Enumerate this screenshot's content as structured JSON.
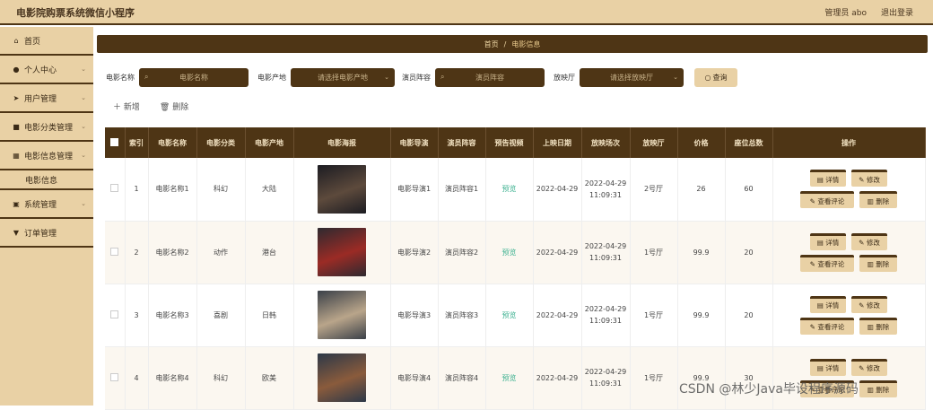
{
  "app": {
    "title": "电影院购票系统微信小程序"
  },
  "header": {
    "user_label": "管理员 abo",
    "logout": "退出登录"
  },
  "sidebar": {
    "items": [
      {
        "label": "首页",
        "icon": "home-icon",
        "glyph": "⌂",
        "has_chevron": false
      },
      {
        "label": "个人中心",
        "icon": "person-icon",
        "glyph": "●",
        "has_chevron": true
      },
      {
        "label": "用户管理",
        "icon": "send-icon",
        "glyph": "➤",
        "has_chevron": true
      },
      {
        "label": "电影分类管理",
        "icon": "folder-icon",
        "glyph": "■",
        "has_chevron": true
      },
      {
        "label": "电影信息管理",
        "icon": "grid-icon",
        "glyph": "▦",
        "has_chevron": true
      }
    ],
    "subitem": "电影信息",
    "items2": [
      {
        "label": "系统管理",
        "icon": "settings-icon",
        "glyph": "▣",
        "has_chevron": true
      },
      {
        "label": "订单管理",
        "icon": "pin-icon",
        "glyph": "▼",
        "has_chevron": false
      }
    ]
  },
  "breadcrumb": {
    "home": "首页",
    "sep": "/",
    "current": "电影信息"
  },
  "search": {
    "name_label": "电影名称",
    "name_placeholder": "电影名称",
    "region_label": "电影产地",
    "region_placeholder": "请选择电影产地",
    "cast_label": "演员阵容",
    "cast_placeholder": "演员阵容",
    "hall_label": "放映厅",
    "hall_placeholder": "请选择放映厅",
    "query": "查询"
  },
  "toolbar": {
    "add": "新增",
    "delete": "删除"
  },
  "table": {
    "headers": [
      "索引",
      "电影名称",
      "电影分类",
      "电影产地",
      "电影海报",
      "电影导演",
      "演员阵容",
      "预告视频",
      "上映日期",
      "放映场次",
      "放映厅",
      "价格",
      "座位总数",
      "操作"
    ],
    "rows": [
      {
        "idx": "1",
        "name": "电影名称1",
        "cat": "科幻",
        "region": "大陆",
        "director": "电影导演1",
        "cast": "演员阵容1",
        "trailer": "预览",
        "date": "2022-04-29",
        "session_date": "2022-04-29",
        "session_time": "11:09:31",
        "hall": "2号厅",
        "price": "26",
        "seats": "60",
        "poster_colors": [
          "#1c1c22",
          "#5d4a3c"
        ]
      },
      {
        "idx": "2",
        "name": "电影名称2",
        "cat": "动作",
        "region": "港台",
        "director": "电影导演2",
        "cast": "演员阵容2",
        "trailer": "预览",
        "date": "2022-04-29",
        "session_date": "2022-04-29",
        "session_time": "11:09:31",
        "hall": "1号厅",
        "price": "99.9",
        "seats": "20",
        "poster_colors": [
          "#2e2a30",
          "#9b2b25"
        ]
      },
      {
        "idx": "3",
        "name": "电影名称3",
        "cat": "喜剧",
        "region": "日韩",
        "director": "电影导演3",
        "cast": "演员阵容3",
        "trailer": "预览",
        "date": "2022-04-29",
        "session_date": "2022-04-29",
        "session_time": "11:09:31",
        "hall": "1号厅",
        "price": "99.9",
        "seats": "20",
        "poster_colors": [
          "#3a4048",
          "#b9a58a"
        ]
      },
      {
        "idx": "4",
        "name": "电影名称4",
        "cat": "科幻",
        "region": "欧美",
        "director": "电影导演4",
        "cast": "演员阵容4",
        "trailer": "预览",
        "date": "2022-04-29",
        "session_date": "2022-04-29",
        "session_time": "11:09:31",
        "hall": "1号厅",
        "price": "99.9",
        "seats": "30",
        "poster_colors": [
          "#2c3848",
          "#8a5b3c"
        ]
      }
    ],
    "ops": {
      "detail": "详情",
      "edit": "修改",
      "comments": "查看评论",
      "remove": "删除"
    }
  },
  "watermark": "CSDN @林少Java毕设程序源码"
}
